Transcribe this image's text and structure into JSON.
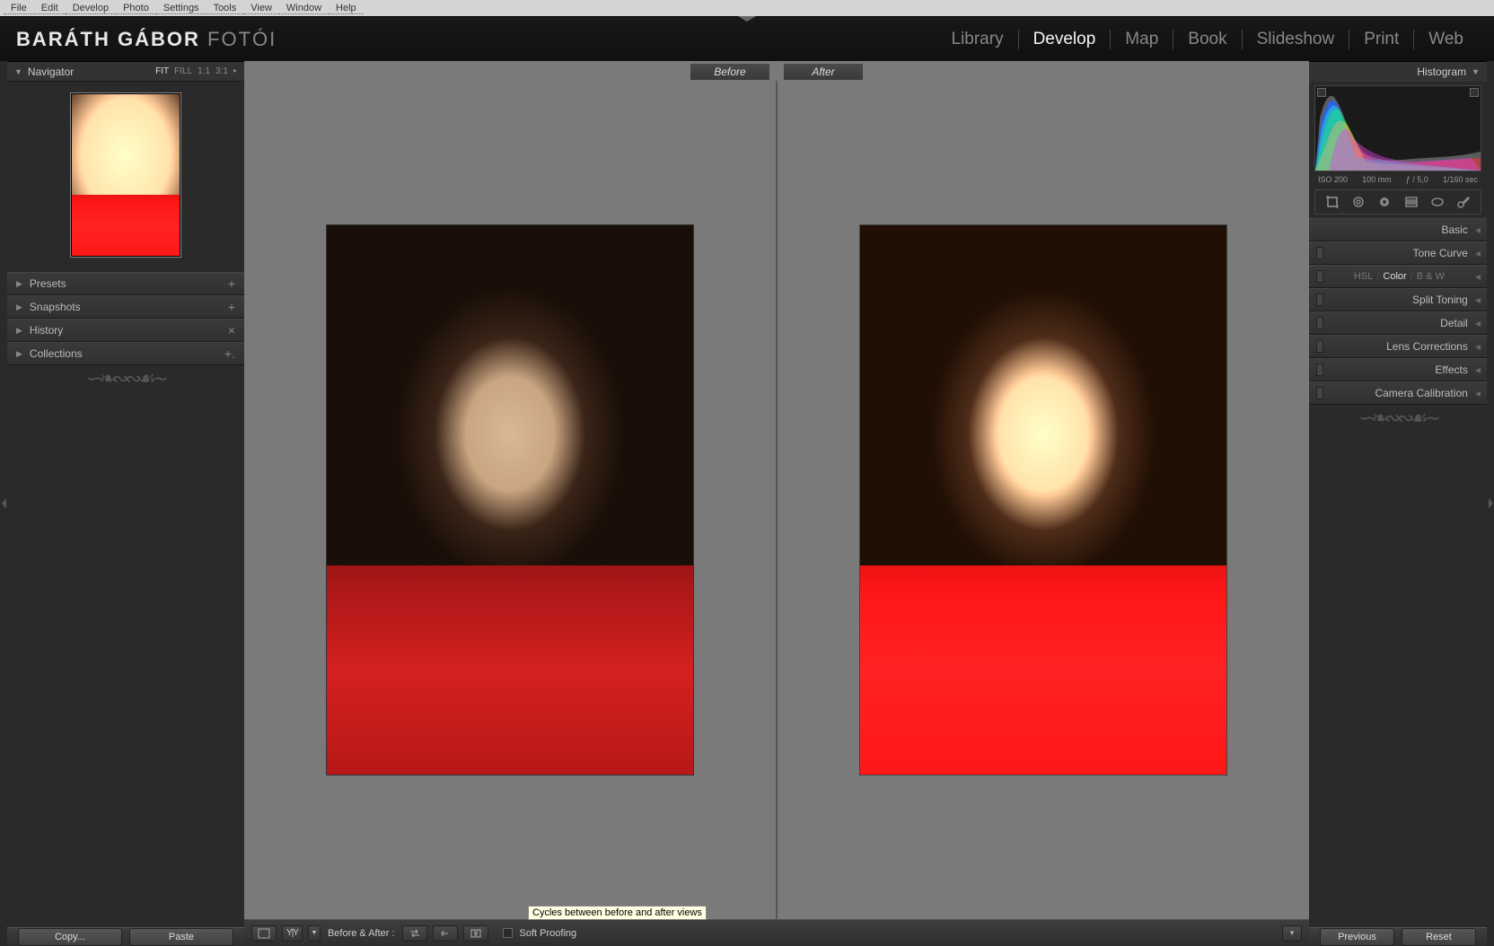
{
  "menubar": [
    "File",
    "Edit",
    "Develop",
    "Photo",
    "Settings",
    "Tools",
    "View",
    "Window",
    "Help"
  ],
  "brand": {
    "bold": "BARÁTH GÁBOR",
    "light": "FOTÓI"
  },
  "modules": [
    "Library",
    "Develop",
    "Map",
    "Book",
    "Slideshow",
    "Print",
    "Web"
  ],
  "active_module": "Develop",
  "navigator": {
    "title": "Navigator",
    "zoom": [
      "FIT",
      "FILL",
      "1:1",
      "3:1"
    ],
    "zoom_active": "FIT"
  },
  "left_sections": [
    {
      "label": "Presets",
      "icon": "+"
    },
    {
      "label": "Snapshots",
      "icon": "+"
    },
    {
      "label": "History",
      "icon": "×"
    },
    {
      "label": "Collections",
      "icon": "+."
    }
  ],
  "compare": {
    "before": "Before",
    "after": "After"
  },
  "toolbar": {
    "before_after_label": "Before & After :",
    "tooltip": "Cycles between before and after views",
    "soft_proof": "Soft Proofing"
  },
  "histogram": {
    "title": "Histogram",
    "iso": "ISO 200",
    "focal": "100 mm",
    "aperture": "ƒ / 5,0",
    "shutter": "1/160 sec"
  },
  "right_sections": [
    {
      "label": "Basic"
    },
    {
      "label": "Tone Curve",
      "switch": true
    },
    {
      "label": "Color",
      "switch": true,
      "subtabs": [
        "HSL",
        "Color",
        "B & W"
      ],
      "active_sub": "Color"
    },
    {
      "label": "Split Toning",
      "switch": true
    },
    {
      "label": "Detail",
      "switch": true
    },
    {
      "label": "Lens Corrections",
      "switch": true
    },
    {
      "label": "Effects",
      "switch": true
    },
    {
      "label": "Camera Calibration",
      "switch": true
    }
  ],
  "bottom": {
    "copy": "Copy...",
    "paste": "Paste",
    "previous": "Previous",
    "reset": "Reset"
  }
}
